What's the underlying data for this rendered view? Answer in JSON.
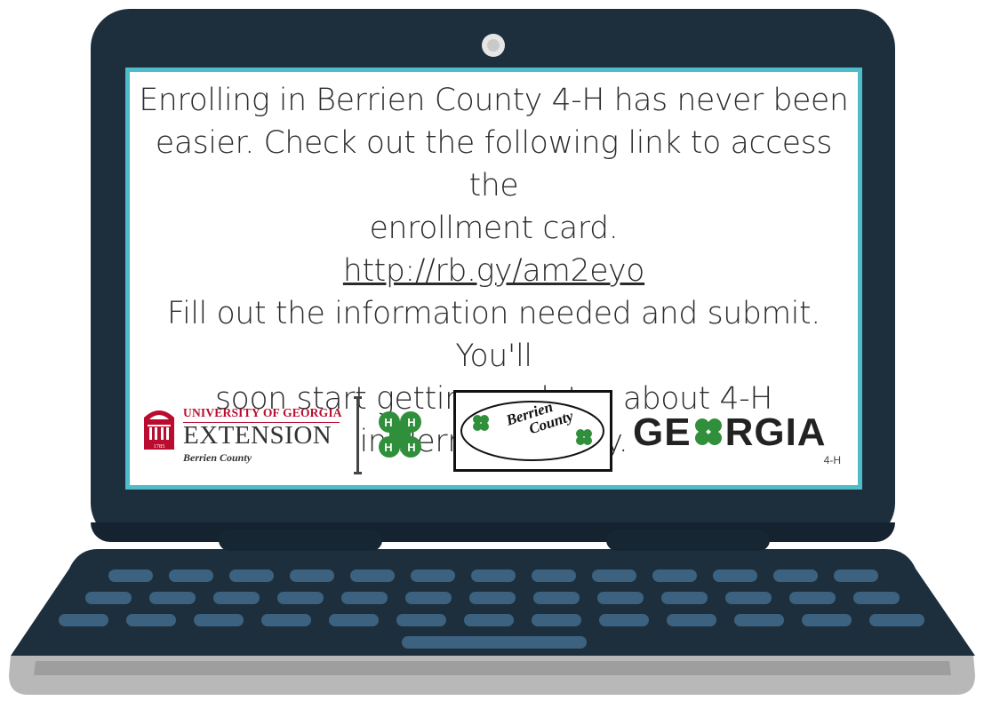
{
  "screen_message": {
    "line1": "Enrolling in Berrien County 4-H has never been",
    "line2": "easier. Check out the following link to access the",
    "line3": "enrollment card.",
    "link": "http://rb.gy/am2eyo",
    "line4": "Fill out the information needed and submit. You'll",
    "line5": "soon start getting updates about 4-H",
    "line6": "in Berrien County."
  },
  "logos": {
    "uga_line1": "UNIVERSITY OF GEORGIA",
    "uga_line2": "EXTENSION",
    "uga_line3": "Berrien County",
    "uga_year": "1785",
    "berrien_line1": "Berrien",
    "berrien_line2": "County",
    "georgia_word": "GE RGIA",
    "georgia_sub": "4-H"
  },
  "colors": {
    "laptop_body": "#1d2f3d",
    "screen_border": "#4fbcc9",
    "keys": "#3c6280",
    "uga_red": "#ba0c2f",
    "clover_green": "#2f8f3a"
  }
}
